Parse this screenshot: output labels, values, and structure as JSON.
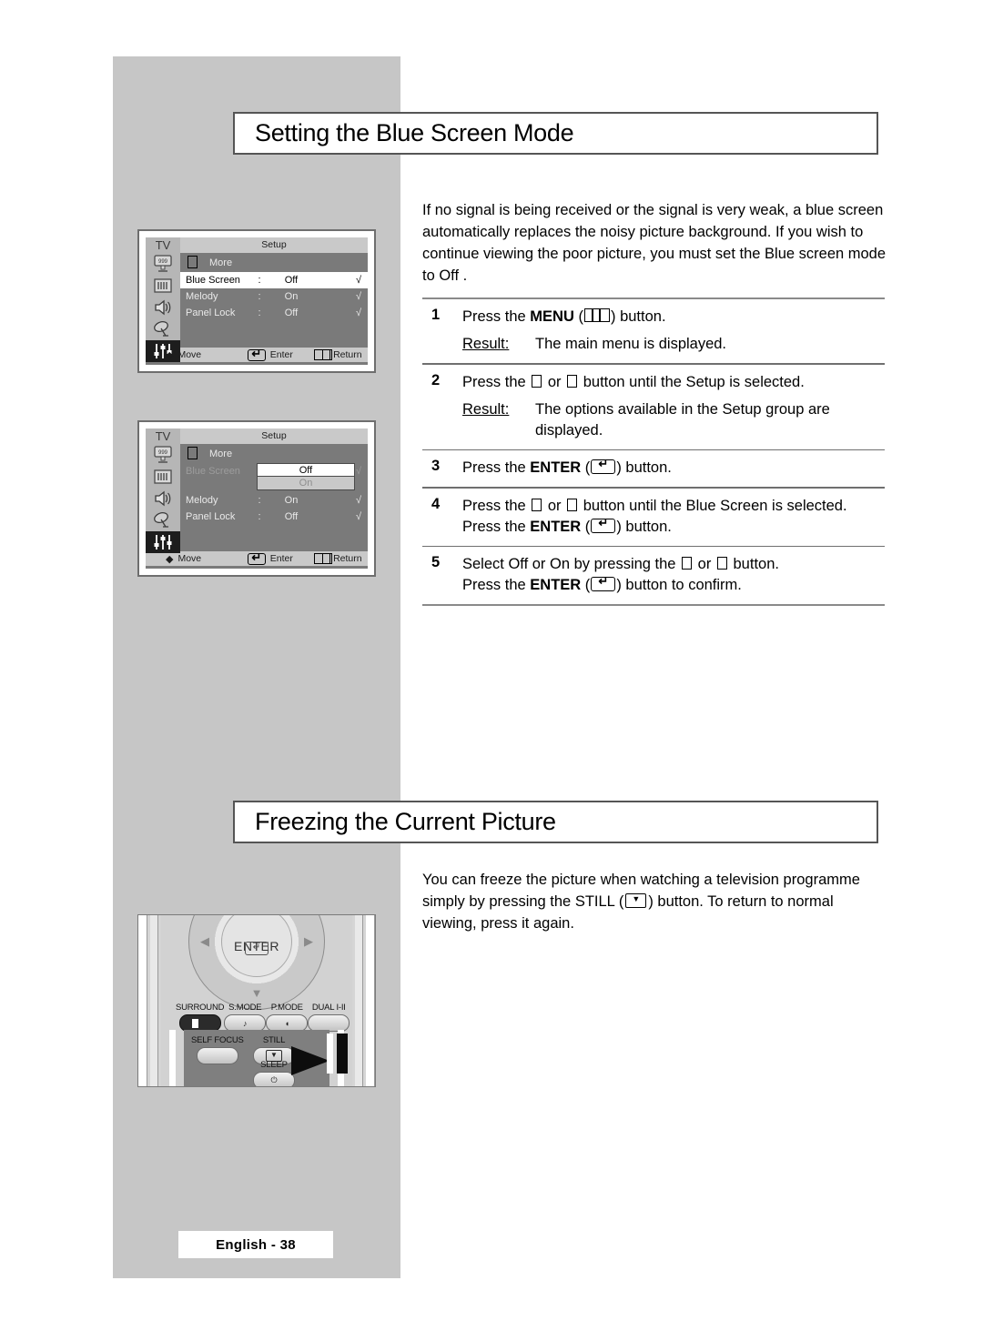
{
  "page": {
    "footer_label": "English - 38",
    "background": "#ffffff",
    "band_color": "#c6c6c6"
  },
  "sections": [
    {
      "title": "Setting the Blue Screen Mode",
      "intro": "If no signal is being received or the signal is very weak, a blue screen automatically replaces the noisy picture background. If you wish to continue viewing the poor picture, you must set the  Blue screen   mode to Off ."
    },
    {
      "title": "Freezing the Current Picture",
      "intro_a": "You can freeze the picture when watching a television programme simply by pressing the  STILL (",
      "intro_b": ") button. To return to normal viewing, press it again."
    }
  ],
  "steps": [
    {
      "num": "1",
      "line1_a": "Press the ",
      "line1_bold": "MENU",
      "line1_b": " (",
      "line1_c": ")  button.",
      "result_label": "Result:",
      "result_text": "The main menu is displayed."
    },
    {
      "num": "2",
      "line1_a": "Press the ",
      "line1_b": " or ",
      "line1_c": " button until the Setup  is selected.",
      "result_label": "Result:",
      "result_text": "The options available in the Setup  group are displayed."
    },
    {
      "num": "3",
      "line1_a": "Press the ",
      "line1_bold": "ENTER",
      "line1_b": " (",
      "line1_c": ") button."
    },
    {
      "num": "4",
      "line1_a": "Press the ",
      "line1_b": " or ",
      "line1_c": " button until the Blue Screen      is selected.",
      "line2_a": "Press the ",
      "line2_bold": "ENTER",
      "line2_b": " (",
      "line2_c": ") button."
    },
    {
      "num": "5",
      "line1_a": "Select Off  or On  by pressing the ",
      "line1_b": " or ",
      "line1_c": " button.",
      "line2_a": "Press the ",
      "line2_bold": "ENTER",
      "line2_b": " (",
      "line2_c": ") button to confirm."
    }
  ],
  "osd": {
    "tv_label": "TV",
    "menu_caption": "Setup",
    "more_label": "More",
    "colon": ":",
    "check": "√",
    "rows": [
      {
        "label": "Blue Screen",
        "value": "Off"
      },
      {
        "label": "Melody",
        "value": "On"
      },
      {
        "label": "Panel Lock",
        "value": "Off"
      }
    ],
    "footer": {
      "move": "Move",
      "enter": "Enter",
      "return": "Return"
    },
    "dropdown": {
      "option_selected": "Off",
      "option_other": "On"
    }
  },
  "remote": {
    "enter_label": "ENTER",
    "buttons": [
      {
        "caption": "SURROUND"
      },
      {
        "caption": "S.MODE"
      },
      {
        "caption": "P.MODE"
      },
      {
        "caption": "DUAL I-II"
      }
    ],
    "lower_buttons": [
      {
        "caption": "SELF FOCUS"
      },
      {
        "caption": "STILL"
      },
      {
        "caption": "SLEEP"
      }
    ]
  }
}
